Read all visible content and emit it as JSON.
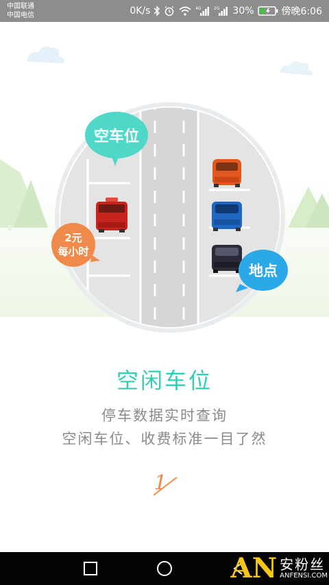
{
  "status_bar": {
    "carrier_1": "中国联通",
    "carrier_2": "中国电信",
    "net_speed": "0K/s",
    "signal_1_tag": "4G",
    "signal_2_tag": "2G",
    "battery": "30%",
    "time": "傍晚6:06",
    "icons": [
      "bluetooth-icon",
      "alarm-icon",
      "wifi-icon",
      "signal-icon",
      "battery-icon"
    ]
  },
  "illustration": {
    "bubble_top": "空车位",
    "bubble_price_line1": "2元",
    "bubble_price_line2": "每小时",
    "bubble_location": "地点"
  },
  "onboarding": {
    "title": "空闲车位",
    "desc_1": "停车数据实时查询",
    "desc_2": "空闲车位、收费标准一目了然",
    "page_number": "1"
  },
  "nav_bar": {
    "buttons": [
      "back-icon",
      "home-icon",
      "recents-icon"
    ]
  },
  "watermark": {
    "logo": "AN",
    "cn": "安粉丝",
    "en": "ANFENSI.COM"
  },
  "colors": {
    "accent": "#2fcfb5",
    "bubble_teal": "#4fd8c8",
    "bubble_orange": "#f08a4a",
    "bubble_blue": "#2aa8e8",
    "status_bar": "#8d8d8d",
    "nav_bar": "#050505"
  }
}
